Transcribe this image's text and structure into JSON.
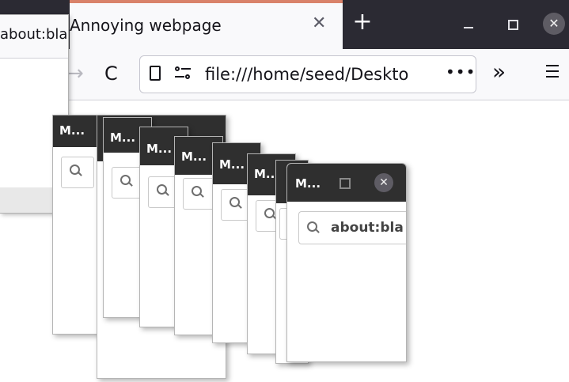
{
  "browser": {
    "tab_title": "Annoying webpage",
    "tab_close": "✕",
    "new_tab": "+",
    "close_window": "✕",
    "url": "file:///home/seed/Deskto",
    "url_more": "•••",
    "overflow": "»",
    "reload": "C",
    "back": "→"
  },
  "back_popup": {
    "url_text": "about:bla"
  },
  "popups": {
    "title": "M...",
    "short_title": "M.."
  },
  "front_popup": {
    "title": "M...",
    "close": "✕",
    "url_text": "about:bla"
  },
  "colors": {
    "title_bar": "#2f2f2f",
    "tab_strip": "#2b2a33",
    "tab_accent": "#d9826a"
  }
}
